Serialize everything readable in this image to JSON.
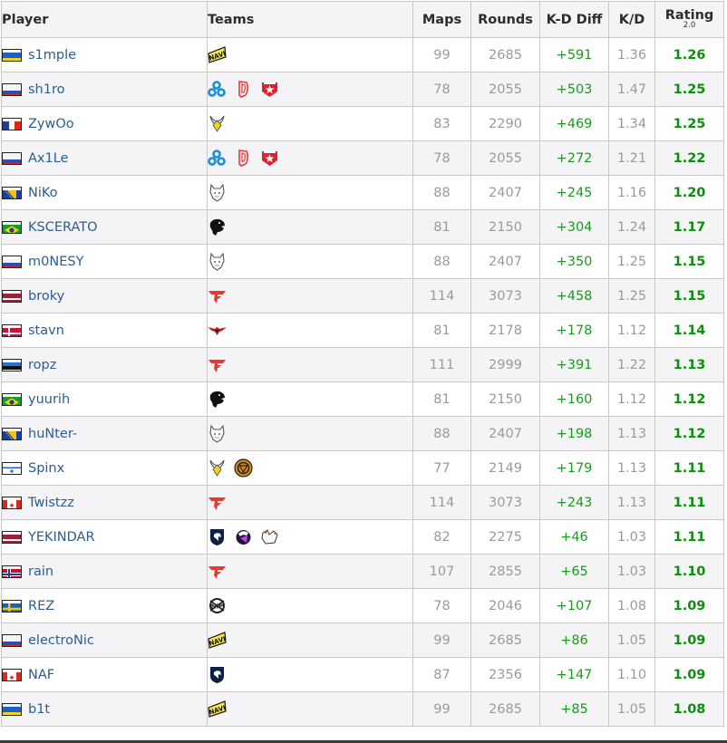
{
  "table": {
    "headers": {
      "player": "Player",
      "teams": "Teams",
      "maps": "Maps",
      "rounds": "Rounds",
      "kd_diff": "K-D Diff",
      "kd": "K/D",
      "rating": "Rating",
      "rating_version": "2.0"
    },
    "colors": {
      "player_link": "#2a5d93",
      "positive_diff": "#1a9a1a",
      "rating": "#0d8f0d",
      "muted_number": "#9a9a9a",
      "header_bg": "#f4f4f6",
      "stripe_bg": "#f4f4f6",
      "border": "#c8c8c8"
    },
    "rows": [
      {
        "player": "s1mple",
        "flag": "ukraine-flag",
        "teams": [
          "natus-vincere"
        ],
        "maps": "99",
        "rounds": "2685",
        "kd_diff": "+591",
        "kd": "1.36",
        "rating": "1.26"
      },
      {
        "player": "sh1ro",
        "flag": "russia-flag",
        "teams": [
          "cloud9",
          "dignitas",
          "gambit"
        ],
        "maps": "78",
        "rounds": "2055",
        "kd_diff": "+503",
        "kd": "1.47",
        "rating": "1.25"
      },
      {
        "player": "ZywOo",
        "flag": "france-flag",
        "teams": [
          "vitality"
        ],
        "maps": "83",
        "rounds": "2290",
        "kd_diff": "+469",
        "kd": "1.34",
        "rating": "1.25"
      },
      {
        "player": "Ax1Le",
        "flag": "russia-flag",
        "teams": [
          "cloud9",
          "dignitas",
          "gambit"
        ],
        "maps": "78",
        "rounds": "2055",
        "kd_diff": "+272",
        "kd": "1.21",
        "rating": "1.22"
      },
      {
        "player": "NiKo",
        "flag": "bosnia-flag",
        "teams": [
          "g2"
        ],
        "maps": "88",
        "rounds": "2407",
        "kd_diff": "+245",
        "kd": "1.16",
        "rating": "1.20"
      },
      {
        "player": "KSCERATO",
        "flag": "brazil-flag",
        "teams": [
          "furia"
        ],
        "maps": "81",
        "rounds": "2150",
        "kd_diff": "+304",
        "kd": "1.24",
        "rating": "1.17"
      },
      {
        "player": "m0NESY",
        "flag": "russia-flag",
        "teams": [
          "g2"
        ],
        "maps": "88",
        "rounds": "2407",
        "kd_diff": "+350",
        "kd": "1.25",
        "rating": "1.15"
      },
      {
        "player": "broky",
        "flag": "latvia-flag",
        "teams": [
          "faze"
        ],
        "maps": "114",
        "rounds": "3073",
        "kd_diff": "+458",
        "kd": "1.25",
        "rating": "1.15"
      },
      {
        "player": "stavn",
        "flag": "denmark-flag",
        "teams": [
          "heroic"
        ],
        "maps": "81",
        "rounds": "2178",
        "kd_diff": "+178",
        "kd": "1.12",
        "rating": "1.14"
      },
      {
        "player": "ropz",
        "flag": "estonia-flag",
        "teams": [
          "faze"
        ],
        "maps": "111",
        "rounds": "2999",
        "kd_diff": "+391",
        "kd": "1.22",
        "rating": "1.13"
      },
      {
        "player": "yuurih",
        "flag": "brazil-flag",
        "teams": [
          "furia"
        ],
        "maps": "81",
        "rounds": "2150",
        "kd_diff": "+160",
        "kd": "1.12",
        "rating": "1.12"
      },
      {
        "player": "huNter-",
        "flag": "bosnia-flag",
        "teams": [
          "g2"
        ],
        "maps": "88",
        "rounds": "2407",
        "kd_diff": "+198",
        "kd": "1.13",
        "rating": "1.12"
      },
      {
        "player": "Spinx",
        "flag": "israel-flag",
        "teams": [
          "vitality",
          "ence"
        ],
        "maps": "77",
        "rounds": "2149",
        "kd_diff": "+179",
        "kd": "1.13",
        "rating": "1.11"
      },
      {
        "player": "Twistzz",
        "flag": "canada-flag",
        "teams": [
          "faze"
        ],
        "maps": "114",
        "rounds": "3073",
        "kd_diff": "+243",
        "kd": "1.13",
        "rating": "1.11"
      },
      {
        "player": "YEKINDAR",
        "flag": "latvia-flag",
        "teams": [
          "liquid",
          "outsiders",
          "virtus-pro"
        ],
        "maps": "82",
        "rounds": "2275",
        "kd_diff": "+46",
        "kd": "1.03",
        "rating": "1.11"
      },
      {
        "player": "rain",
        "flag": "norway-flag",
        "teams": [
          "faze"
        ],
        "maps": "107",
        "rounds": "2855",
        "kd_diff": "+65",
        "kd": "1.03",
        "rating": "1.10"
      },
      {
        "player": "REZ",
        "flag": "sweden-flag",
        "teams": [
          "nip"
        ],
        "maps": "78",
        "rounds": "2046",
        "kd_diff": "+107",
        "kd": "1.08",
        "rating": "1.09"
      },
      {
        "player": "electroNic",
        "flag": "russia-flag",
        "teams": [
          "natus-vincere"
        ],
        "maps": "99",
        "rounds": "2685",
        "kd_diff": "+86",
        "kd": "1.05",
        "rating": "1.09"
      },
      {
        "player": "NAF",
        "flag": "canada-flag",
        "teams": [
          "liquid"
        ],
        "maps": "87",
        "rounds": "2356",
        "kd_diff": "+147",
        "kd": "1.10",
        "rating": "1.09"
      },
      {
        "player": "b1t",
        "flag": "ukraine-flag",
        "teams": [
          "natus-vincere"
        ],
        "maps": "99",
        "rounds": "2685",
        "kd_diff": "+85",
        "kd": "1.05",
        "rating": "1.08"
      }
    ]
  }
}
